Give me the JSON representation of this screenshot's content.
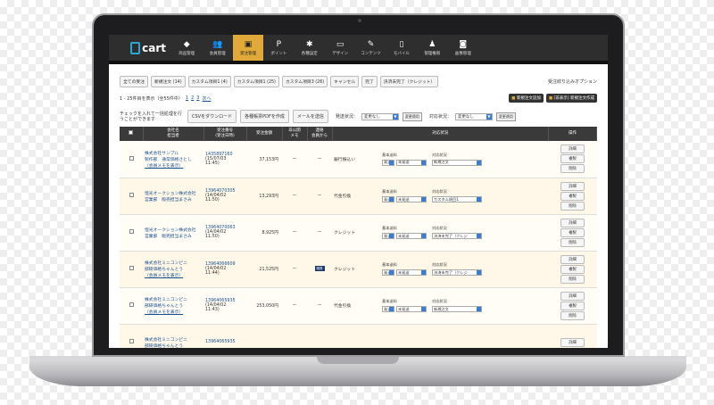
{
  "app": {
    "logo_text": "cart",
    "accent": "#e0a93a",
    "nav_bg": "#2e2e2e"
  },
  "nav": [
    {
      "label": "商品管理",
      "icon": "tag-icon",
      "glyph": "◆"
    },
    {
      "label": "会員管理",
      "icon": "users-icon",
      "glyph": "👥"
    },
    {
      "label": "受注管理",
      "icon": "truck-icon",
      "glyph": "▣",
      "active": true
    },
    {
      "label": "ポイント",
      "icon": "point-icon",
      "glyph": "P"
    },
    {
      "label": "各種設定",
      "icon": "gear-icon",
      "glyph": "✱"
    },
    {
      "label": "デザイン",
      "icon": "monitor-icon",
      "glyph": "▭"
    },
    {
      "label": "コンテンツ",
      "icon": "edit-icon",
      "glyph": "✎"
    },
    {
      "label": "モバイル",
      "icon": "mobile-icon",
      "glyph": "▯"
    },
    {
      "label": "管理権限",
      "icon": "admin-icon",
      "glyph": "♟"
    },
    {
      "label": "画像管理",
      "icon": "camera-icon",
      "glyph": "◙"
    }
  ],
  "filters": {
    "items": [
      "全ての受注",
      "新規注文 (14)",
      "カスタム項目1 (4)",
      "カスタム項目1 (25)",
      "カスタム項目3 (26)",
      "キャンセル",
      "完了",
      "決済未完了（クレジット）"
    ],
    "option_label": "受注絞り込みオプション"
  },
  "pager": {
    "summary": "1 - 25件目を表示（全55件中）",
    "pages": [
      "1",
      "2",
      "3"
    ],
    "next": "次へ",
    "add_order": "新規注文追加",
    "urgent_order": "[非表示] 新規注文作成"
  },
  "toolbar": {
    "check_note": "チェックを入れて一括処理を行うことができます",
    "csv": "CSVをダウンロード",
    "pdf": "各種帳票PDFを作成",
    "mail": "メールを送信",
    "ship_label": "発送状況：",
    "ship_value": "変更なし",
    "change": "変更適用",
    "resp_label": "対応状況：",
    "resp_value": "変更なし"
  },
  "table": {
    "headers": [
      "会社名\n担当者",
      "受注番号\n(受注日時)",
      "受注金額",
      "非公開\nメモ",
      "連絡\n会員から",
      "対応状況",
      "操作"
    ],
    "status_labels": {
      "basic": "基本送料",
      "resp": "対応状況"
    },
    "actions": [
      "詳細",
      "複製",
      "削除"
    ],
    "rows": [
      {
        "company": "株式会社サンプル",
        "person": "製作部　通常価格さとし",
        "memo_link": "（会員メモを表示）",
        "order_no": "1435897160",
        "date": "(15/07/03",
        "time": "11:45)",
        "amount": "37,153円",
        "memo": "—",
        "contact": "—",
        "payment": "銀行振込い",
        "ship_a": "発送",
        "ship_b": "未発送",
        "resp": "新規注文",
        "badge": ""
      },
      {
        "company": "恒光オークション株式会社",
        "person": "営業部　販売担当まさみ",
        "memo_link": "",
        "order_no": "13964070305",
        "date": "(14/04/02",
        "time": "11:50)",
        "amount": "13,293円",
        "memo": "—",
        "contact": "—",
        "payment": "代金引換",
        "ship_a": "発送",
        "ship_b": "未発送",
        "resp": "カスタム項目1",
        "badge": ""
      },
      {
        "company": "恒光オークション株式会社",
        "person": "営業部　販売担当まさみ",
        "memo_link": "",
        "order_no": "13964070063",
        "date": "(14/04/02",
        "time": "11:50)",
        "amount": "8,925円",
        "memo": "—",
        "contact": "—",
        "payment": "クレジット",
        "ship_a": "発送",
        "ship_b": "未発送",
        "resp": "決済未完了（クレジ",
        "badge": ""
      },
      {
        "company": "株式会社ミニコンピニ",
        "person": "部研価格ちゃんとう",
        "memo_link": "（会員メモを表示）",
        "order_no": "13964066609",
        "date": "(14/04/02",
        "time": "11:44)",
        "amount": "21,525円",
        "memo": "—",
        "contact": "",
        "payment": "クレジット",
        "ship_a": "発送",
        "ship_b": "未発送",
        "resp": "決済未完了（クレジ",
        "badge": "精算"
      },
      {
        "company": "株式会社ミニコンピニ",
        "person": "部研価格ちゃんとう",
        "memo_link": "（会員メモを表示）",
        "order_no": "13964065935",
        "date": "(14/04/02",
        "time": "11:43)",
        "amount": "253,050円",
        "memo": "—",
        "contact": "—",
        "payment": "代金引換",
        "ship_a": "発送",
        "ship_b": "未発送",
        "resp": "新規注文",
        "badge": ""
      },
      {
        "company": "株式会社ミニコンピニ",
        "person": "部研価格ちゃんとう",
        "memo_link": "",
        "order_no": "13964065935",
        "date": "",
        "time": "",
        "amount": "",
        "memo": "",
        "contact": "",
        "payment": "",
        "ship_a": "",
        "ship_b": "",
        "resp": "",
        "badge": ""
      }
    ]
  }
}
